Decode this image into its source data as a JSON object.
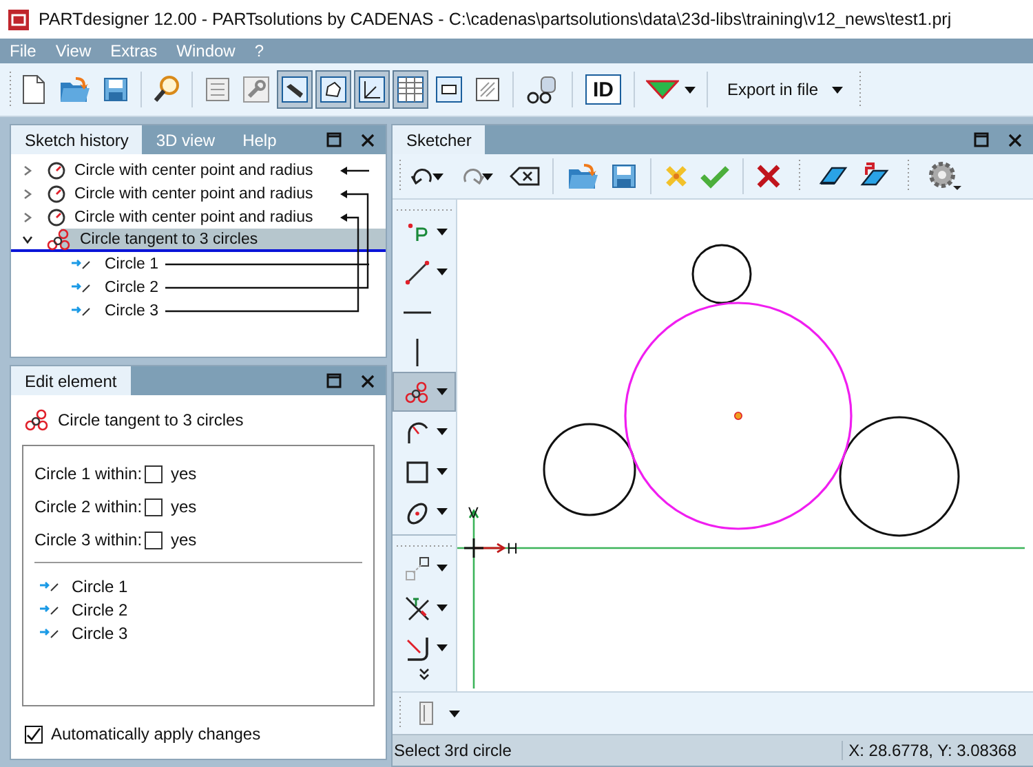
{
  "window": {
    "title": "PARTdesigner 12.00 - PARTsolutions by CADENAS - C:\\cadenas\\partsolutions\\data\\23d-libs\\training\\v12_news\\test1.prj"
  },
  "menu": [
    "File",
    "View",
    "Extras",
    "Window",
    "?"
  ],
  "toolbar": [
    {
      "kind": "new",
      "pressed": false
    },
    {
      "kind": "open",
      "pressed": false
    },
    {
      "kind": "save",
      "pressed": false
    },
    {
      "kind": "separator"
    },
    {
      "kind": "search",
      "pressed": false
    },
    {
      "kind": "separator"
    },
    {
      "kind": "frame",
      "pressed": false
    },
    {
      "kind": "wrench",
      "pressed": false
    },
    {
      "kind": "part",
      "pressed": true
    },
    {
      "kind": "shape",
      "pressed": true
    },
    {
      "kind": "axes",
      "pressed": true
    },
    {
      "kind": "table",
      "pressed": true
    },
    {
      "kind": "plug",
      "pressed": false
    },
    {
      "kind": "hatch",
      "pressed": false
    },
    {
      "kind": "separator"
    },
    {
      "kind": "glasses",
      "pressed": false
    },
    {
      "kind": "separator"
    },
    {
      "kind": "label",
      "label": "ID",
      "pressed": false
    },
    {
      "kind": "separator"
    },
    {
      "kind": "triangle",
      "pressed": false,
      "dropdown": true
    },
    {
      "kind": "separator"
    },
    {
      "kind": "text",
      "label": "Export in file",
      "pressed": false,
      "dropdown": true
    }
  ],
  "sketch_history": {
    "tabs": [
      {
        "label": "Sketch history",
        "selected": true
      },
      {
        "label": "3D view",
        "selected": false
      },
      {
        "label": "Help",
        "selected": false
      }
    ],
    "tree": [
      {
        "label": "Circle with center point and radius",
        "kind": "circle",
        "expanded": false,
        "selected": false
      },
      {
        "label": "Circle with center point and radius",
        "kind": "circle",
        "expanded": false,
        "selected": false
      },
      {
        "label": "Circle with center point and radius",
        "kind": "circle",
        "expanded": false,
        "selected": false
      },
      {
        "label": "Circle tangent to 3 circles",
        "kind": "tangent",
        "expanded": true,
        "selected": true,
        "children": [
          {
            "label": "Circle 1"
          },
          {
            "label": "Circle 2"
          },
          {
            "label": "Circle 3"
          }
        ]
      }
    ]
  },
  "edit_element": {
    "tab": "Edit element",
    "title": "Circle tangent to 3 circles",
    "options": [
      {
        "label": "Circle 1 within:",
        "option": "yes",
        "checked": false
      },
      {
        "label": "Circle 2 within:",
        "option": "yes",
        "checked": false
      },
      {
        "label": "Circle 3 within:",
        "option": "yes",
        "checked": false
      }
    ],
    "circles": [
      "Circle 1",
      "Circle 2",
      "Circle 3"
    ],
    "auto_apply": {
      "label": "Automatically apply changes",
      "checked": true
    }
  },
  "sketcher": {
    "tab": "Sketcher",
    "toolbar": [
      {
        "kind": "undo",
        "dropdown": true
      },
      {
        "kind": "redo",
        "dropdown": true
      },
      {
        "kind": "clear"
      },
      {
        "kind": "separator"
      },
      {
        "kind": "open"
      },
      {
        "kind": "save"
      },
      {
        "kind": "separator"
      },
      {
        "kind": "star"
      },
      {
        "kind": "check"
      },
      {
        "kind": "separator"
      },
      {
        "kind": "delete"
      },
      {
        "kind": "grip"
      },
      {
        "kind": "eraser"
      },
      {
        "kind": "eraser2"
      },
      {
        "kind": "grip"
      },
      {
        "kind": "gear"
      }
    ],
    "tools": [
      {
        "kind": "point",
        "dropdown": true,
        "selected": false
      },
      {
        "kind": "line",
        "dropdown": true,
        "selected": false
      },
      {
        "kind": "hline",
        "dropdown": false,
        "selected": false
      },
      {
        "kind": "vline",
        "dropdown": false,
        "selected": false
      },
      {
        "kind": "tangent",
        "dropdown": true,
        "selected": true
      },
      {
        "kind": "arc",
        "dropdown": true,
        "selected": false
      },
      {
        "kind": "rect",
        "dropdown": true,
        "selected": false
      },
      {
        "kind": "ellipse",
        "dropdown": true,
        "selected": false
      },
      {
        "kind": "separator"
      },
      {
        "kind": "move",
        "dropdown": true,
        "selected": false
      },
      {
        "kind": "trim",
        "dropdown": true,
        "selected": false
      },
      {
        "kind": "fillet",
        "dropdown": true,
        "selected": false
      },
      {
        "kind": "more"
      }
    ],
    "axis_labels": {
      "vertical": "V",
      "horizontal": "H"
    },
    "status": "Select 3rd circle",
    "coordinates": "X: 28.6778, Y: 3.08368"
  }
}
